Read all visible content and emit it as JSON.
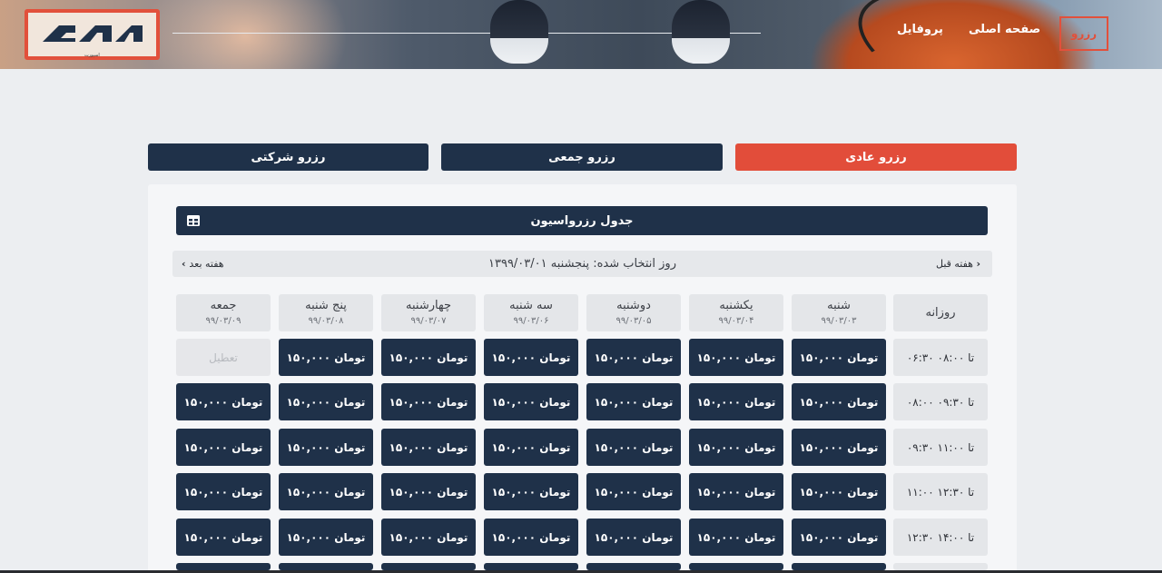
{
  "header": {
    "logo_subtitle": "اسپورت",
    "nav": {
      "reserve": "رزرو",
      "home": "صفحه اصلی",
      "profile": "پروفایل"
    }
  },
  "tabs": [
    {
      "label": "رزرو عادی",
      "active": true
    },
    {
      "label": "رزرو جمعی",
      "active": false
    },
    {
      "label": "رزرو شرکتی",
      "active": false
    }
  ],
  "table": {
    "title": "جدول رزرواسیون",
    "icon": "table-icon",
    "prev_week": "هفته قبل",
    "next_week": "هفته بعد",
    "selected_day": "روز انتخاب شده: پنجشنبه ۱۳۹۹/۰۳/۰۱",
    "corner": "روزانه",
    "days": [
      {
        "name": "شنبه",
        "date": "۹۹/۰۳/۰۳"
      },
      {
        "name": "یکشنبه",
        "date": "۹۹/۰۳/۰۴"
      },
      {
        "name": "دوشنبه",
        "date": "۹۹/۰۳/۰۵"
      },
      {
        "name": "سه شنبه",
        "date": "۹۹/۰۳/۰۶"
      },
      {
        "name": "چهارشنبه",
        "date": "۹۹/۰۳/۰۷"
      },
      {
        "name": "پنج شنبه",
        "date": "۹۹/۰۳/۰۸"
      },
      {
        "name": "جمعه",
        "date": "۹۹/۰۳/۰۹"
      }
    ],
    "rows": [
      {
        "time": "۰۶:۳۰ تا ۰۸:۰۰",
        "cells": [
          "۱۵۰,۰۰۰ تومان",
          "۱۵۰,۰۰۰ تومان",
          "۱۵۰,۰۰۰ تومان",
          "۱۵۰,۰۰۰ تومان",
          "۱۵۰,۰۰۰ تومان",
          "۱۵۰,۰۰۰ تومان",
          "تعطیل"
        ]
      },
      {
        "time": "۰۸:۰۰ تا ۰۹:۳۰",
        "cells": [
          "۱۵۰,۰۰۰ تومان",
          "۱۵۰,۰۰۰ تومان",
          "۱۵۰,۰۰۰ تومان",
          "۱۵۰,۰۰۰ تومان",
          "۱۵۰,۰۰۰ تومان",
          "۱۵۰,۰۰۰ تومان",
          "۱۵۰,۰۰۰ تومان"
        ]
      },
      {
        "time": "۰۹:۳۰ تا ۱۱:۰۰",
        "cells": [
          "۱۵۰,۰۰۰ تومان",
          "۱۵۰,۰۰۰ تومان",
          "۱۵۰,۰۰۰ تومان",
          "۱۵۰,۰۰۰ تومان",
          "۱۵۰,۰۰۰ تومان",
          "۱۵۰,۰۰۰ تومان",
          "۱۵۰,۰۰۰ تومان"
        ]
      },
      {
        "time": "۱۱:۰۰ تا ۱۲:۳۰",
        "cells": [
          "۱۵۰,۰۰۰ تومان",
          "۱۵۰,۰۰۰ تومان",
          "۱۵۰,۰۰۰ تومان",
          "۱۵۰,۰۰۰ تومان",
          "۱۵۰,۰۰۰ تومان",
          "۱۵۰,۰۰۰ تومان",
          "۱۵۰,۰۰۰ تومان"
        ]
      },
      {
        "time": "۱۲:۳۰ تا ۱۴:۰۰",
        "cells": [
          "۱۵۰,۰۰۰ تومان",
          "۱۵۰,۰۰۰ تومان",
          "۱۵۰,۰۰۰ تومان",
          "۱۵۰,۰۰۰ تومان",
          "۱۵۰,۰۰۰ تومان",
          "۱۵۰,۰۰۰ تومان",
          "۱۵۰,۰۰۰ تومان"
        ]
      }
    ]
  },
  "colors": {
    "accent": "#e24d3a",
    "navy": "#1f3149",
    "background": "#eceef1"
  }
}
